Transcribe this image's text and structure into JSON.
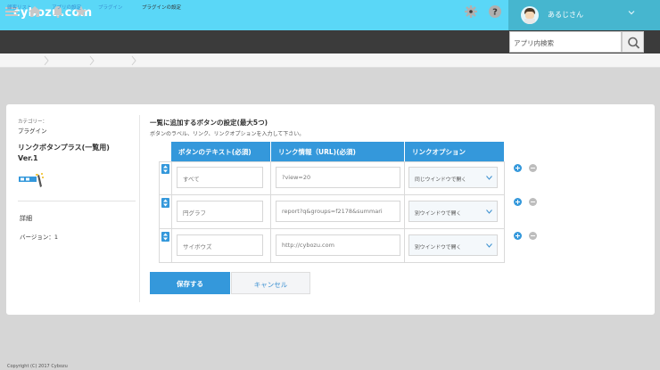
{
  "header": {
    "logo": "cybozu.com",
    "user_name": "あるじさん",
    "search_placeholder": "アプリ内検索"
  },
  "breadcrumb": [
    "顧客リスト",
    "アプリの設定",
    "プラグイン",
    "プラグインの設定"
  ],
  "plugin": {
    "category_label": "カテゴリー：",
    "category_value": "プラグイン",
    "title_line1": "リンクボタンプラス(一覧用)",
    "title_line2": "Ver.1",
    "detail": "詳細",
    "version": "バージョン：1"
  },
  "settings": {
    "title": "一覧に追加するボタンの設定(最大5つ)",
    "description": "ボタンのラベル、リンク、リンクオプションを入力して下さい。",
    "columns": [
      "ボタンのテキスト(必須)",
      "リンク情報（URL)(必須)",
      "リンクオプション"
    ],
    "rows": [
      {
        "label": "すべて",
        "url": "?view=20",
        "option": "同じウインドウで開く"
      },
      {
        "label": "円グラフ",
        "url": "report?q&groups=f2178&summari",
        "option": "別ウインドウで開く"
      },
      {
        "label": "サイボウズ",
        "url": "http://cybozu.com",
        "option": "別ウインドウで開く"
      }
    ],
    "save_label": "保存する",
    "cancel_label": "キャンセル"
  },
  "footer": "Copyright (C) 2017 Cybozu",
  "colors": {
    "topbar": "#5ad7f7",
    "accent": "#3498db",
    "navbar": "#3b3b3b"
  }
}
